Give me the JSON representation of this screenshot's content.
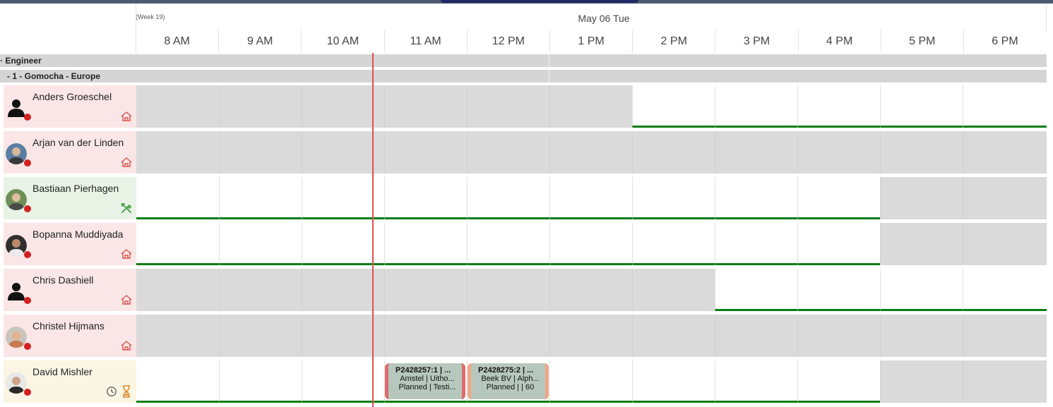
{
  "header": {
    "week_label": "(Week 19)",
    "date_label": "May 06 Tue",
    "hours": [
      "8 AM",
      "9 AM",
      "10 AM",
      "11 AM",
      "12 PM",
      "1 PM",
      "2 PM",
      "3 PM",
      "4 PM",
      "5 PM",
      "6 PM"
    ]
  },
  "groups": {
    "role": "· Engineer",
    "region": " - 1 - Gomocha - Europe"
  },
  "resources": [
    {
      "name": "Anders Groeschel",
      "status_color": "#d32020",
      "icons": [
        "home-icon"
      ]
    },
    {
      "name": "Arjan van der Linden",
      "status_color": "#d32020",
      "icons": [
        "home-icon"
      ]
    },
    {
      "name": "Bastiaan Pierhagen",
      "status_color": "#d32020",
      "icons": [
        "tools-icon"
      ]
    },
    {
      "name": "Bopanna Muddiyada",
      "status_color": "#d32020",
      "icons": [
        "home-icon"
      ]
    },
    {
      "name": "Chris Dashiell",
      "status_color": "#d32020",
      "icons": [
        "home-icon"
      ]
    },
    {
      "name": "Christel Hijmans",
      "status_color": "#d32020",
      "icons": [
        "home-icon"
      ]
    },
    {
      "name": "David Mishler",
      "status_color": "#d32020",
      "icons": [
        "clock-icon",
        "hourglass-icon"
      ]
    }
  ],
  "jobs": [
    {
      "line1": "P2428257:1 | ...",
      "line2": "Amstel | Uitho...",
      "line3": "Planned | Testi...",
      "color": "#b6c8bd",
      "border_color": "#e06b6b"
    },
    {
      "line1": "P2428275:2 | ...",
      "line2": "Beek BV | Alph...",
      "line3": "Planned | | 60",
      "color": "#b6c8bd",
      "border_color": "#f1a488"
    }
  ],
  "colors": {
    "unavailable": "#dadada",
    "available_line": "#0a7d16",
    "now_line": "#e05050",
    "status_offline": "#d32020"
  }
}
